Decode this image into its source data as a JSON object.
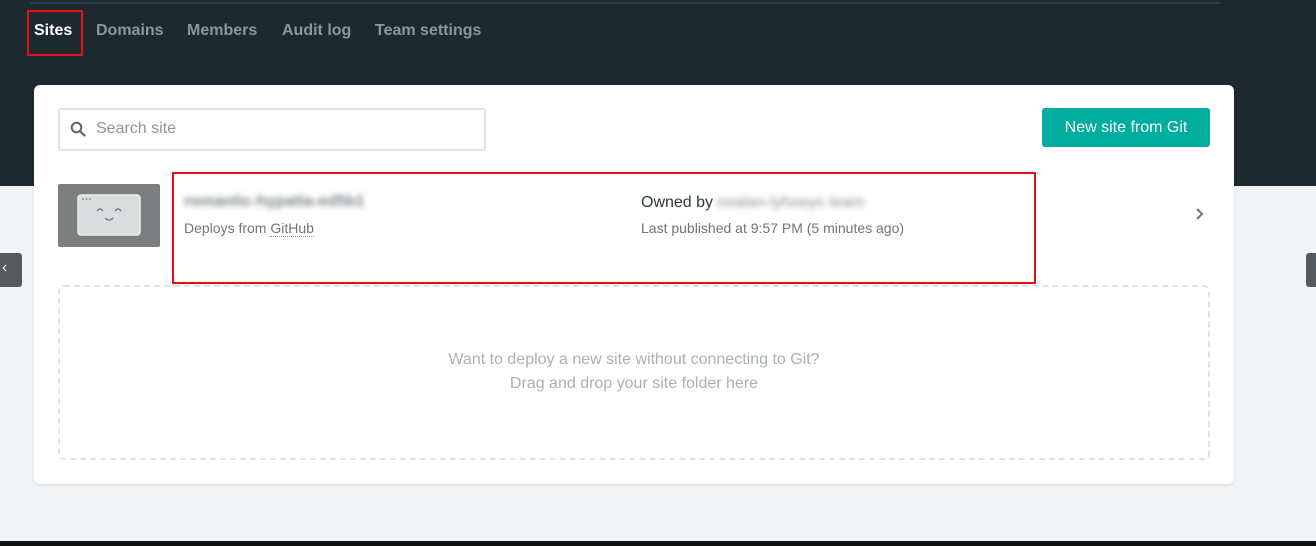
{
  "nav": {
    "tabs": [
      {
        "label": "Sites",
        "active": true
      },
      {
        "label": "Domains"
      },
      {
        "label": "Members"
      },
      {
        "label": "Audit log"
      },
      {
        "label": "Team settings"
      }
    ]
  },
  "search": {
    "placeholder": "Search site",
    "value": "",
    "icon": "search-icon"
  },
  "new_site_button": {
    "label": "New site from Git"
  },
  "site": {
    "name": "romantic-hypatia-ed5b1",
    "deploy_prefix": "Deploys from",
    "deploy_source": "GitHub",
    "owned_prefix": "Owned by",
    "owner": "noalan-lyhoeys team",
    "published": "Last published at 9:57 PM (5 minutes ago)"
  },
  "dropzone": {
    "line1": "Want to deploy a new site without connecting to Git?",
    "line2": "Drag and drop your site folder here"
  },
  "side_tabs": {
    "left_glyph": "‹"
  },
  "colors": {
    "header_bg": "#1c2a30",
    "accent": "#00ad9f",
    "page_bg": "#f2f5f7",
    "highlight_outline": "#e3101a"
  }
}
